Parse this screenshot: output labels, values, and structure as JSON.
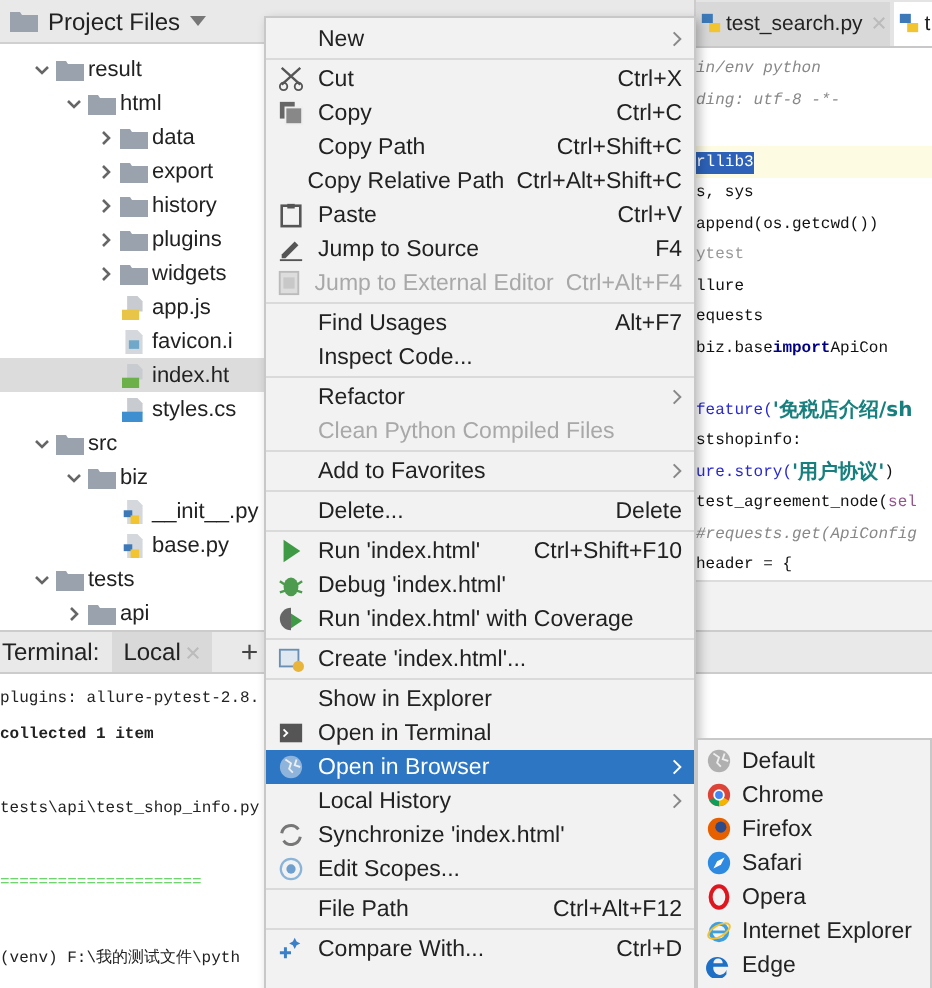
{
  "project": {
    "title": "Project Files",
    "tree": [
      {
        "label": "result",
        "kind": "folder",
        "expanded": true,
        "selected": false,
        "children": [
          {
            "label": "html",
            "kind": "folder",
            "expanded": true,
            "selected": false,
            "children": [
              {
                "label": "data",
                "kind": "folder",
                "expanded": false,
                "selected": false
              },
              {
                "label": "export",
                "kind": "folder",
                "expanded": false,
                "selected": false
              },
              {
                "label": "history",
                "kind": "folder",
                "expanded": false,
                "selected": false
              },
              {
                "label": "plugins",
                "kind": "folder",
                "expanded": false,
                "selected": false
              },
              {
                "label": "widgets",
                "kind": "folder",
                "expanded": false,
                "selected": false
              },
              {
                "label": "app.js",
                "kind": "js",
                "selected": false
              },
              {
                "label": "favicon.i",
                "kind": "image",
                "selected": false
              },
              {
                "label": "index.ht",
                "kind": "html",
                "selected": true
              },
              {
                "label": "styles.cs",
                "kind": "css",
                "selected": false
              }
            ]
          }
        ]
      },
      {
        "label": "src",
        "kind": "folder",
        "expanded": true,
        "selected": false,
        "children": [
          {
            "label": "biz",
            "kind": "folder",
            "expanded": true,
            "selected": false,
            "children": [
              {
                "label": "__init__.py",
                "kind": "python",
                "selected": false
              },
              {
                "label": "base.py",
                "kind": "python",
                "selected": false
              }
            ]
          }
        ]
      },
      {
        "label": "tests",
        "kind": "folder",
        "expanded": true,
        "selected": false,
        "children": [
          {
            "label": "api",
            "kind": "folder",
            "expanded": false,
            "selected": false
          }
        ]
      }
    ]
  },
  "editor": {
    "tabs": [
      {
        "label": "test_search.py",
        "selected": false,
        "closable": true
      },
      {
        "label": "t",
        "selected": true,
        "closable": false
      }
    ],
    "lines": [
      {
        "current": false,
        "segments": [
          {
            "text": "in/env python",
            "kind": "comment"
          }
        ]
      },
      {
        "current": false,
        "segments": [
          {
            "text": "ding: utf-8 -*-",
            "kind": "comment"
          }
        ]
      },
      {
        "current": false
      },
      {
        "current": true,
        "segments": [
          {
            "text": "rllib3",
            "kind": "selection"
          }
        ]
      },
      {
        "current": false,
        "segments": [
          {
            "text": "s, sys",
            "kind": "plain"
          }
        ]
      },
      {
        "current": false,
        "segments": [
          {
            "text": " append(os.getcwd())",
            "kind": "plain"
          }
        ]
      },
      {
        "current": false,
        "segments": [
          {
            "text": "ytest",
            "kind": "dim"
          }
        ]
      },
      {
        "current": false,
        "segments": [
          {
            "text": "llure",
            "kind": "plain"
          }
        ]
      },
      {
        "current": false,
        "segments": [
          {
            "text": "equests",
            "kind": "plain"
          }
        ]
      },
      {
        "current": false,
        "segments": [
          {
            "text": "biz.base ",
            "kind": "plain"
          },
          {
            "text": "import",
            "kind": "keyword"
          },
          {
            "text": " ApiCon",
            "kind": "plain"
          }
        ]
      },
      {
        "current": false
      },
      {
        "current": false,
        "segments": [
          {
            "text": "feature(",
            "kind": "decorator"
          },
          {
            "text": "'免税店介绍/sh",
            "kind": "string"
          }
        ]
      },
      {
        "current": false,
        "segments": [
          {
            "text": "stshopinfo:",
            "kind": "plain"
          }
        ]
      },
      {
        "current": false,
        "segments": [
          {
            "text": "ure.story(",
            "kind": "decorator"
          },
          {
            "text": "'用户协议'",
            "kind": "string"
          },
          {
            "text": ")",
            "kind": "plain"
          }
        ]
      },
      {
        "current": false,
        "segments": [
          {
            "text": "test_agreement_node(",
            "kind": "plain"
          },
          {
            "text": "sel",
            "kind": "self"
          }
        ]
      },
      {
        "current": false,
        "segments": [
          {
            "text": "#requests.get(ApiConfig",
            "kind": "comment"
          }
        ]
      },
      {
        "current": false,
        "segments": [
          {
            "text": "header = {",
            "kind": "plain"
          }
        ]
      }
    ]
  },
  "terminal": {
    "label": "Terminal:",
    "tabs": [
      {
        "label": "Local",
        "selected": true
      }
    ],
    "add": "+",
    "lines": [
      {
        "kind": "plain",
        "text": "plugins: allure-pytest-2.8."
      },
      {
        "kind": "bold",
        "text": "collected 1 item"
      },
      {
        "kind": "blank"
      },
      {
        "kind": "plain",
        "text": "tests\\api\\test_shop_info.py"
      },
      {
        "kind": "blank"
      },
      {
        "kind": "rule",
        "text": "====================="
      },
      {
        "kind": "blank"
      },
      {
        "kind": "plain",
        "text": "(venv) F:\\我的测试文件\\pyth"
      }
    ]
  },
  "menu": {
    "items": [
      {
        "kind": "item",
        "label": "New",
        "has_submenu": true,
        "disabled": false,
        "selected": false
      },
      {
        "kind": "separator"
      },
      {
        "kind": "item",
        "label": "Cut",
        "shortcut": "Ctrl+X",
        "has_submenu": false,
        "disabled": false,
        "selected": false
      },
      {
        "kind": "item",
        "label": "Copy",
        "shortcut": "Ctrl+C",
        "has_submenu": false,
        "disabled": false,
        "selected": false
      },
      {
        "kind": "item",
        "label": "Copy Path",
        "shortcut": "Ctrl+Shift+C",
        "has_submenu": false,
        "disabled": false,
        "selected": false
      },
      {
        "kind": "item",
        "label": "Copy Relative Path",
        "shortcut": "Ctrl+Alt+Shift+C",
        "has_submenu": false,
        "disabled": false,
        "selected": false
      },
      {
        "kind": "item",
        "label": "Paste",
        "shortcut": "Ctrl+V",
        "has_submenu": false,
        "disabled": false,
        "selected": false
      },
      {
        "kind": "item",
        "label": "Jump to Source",
        "shortcut": "F4",
        "has_submenu": false,
        "disabled": false,
        "selected": false
      },
      {
        "kind": "item",
        "label": "Jump to External Editor",
        "shortcut": "Ctrl+Alt+F4",
        "has_submenu": false,
        "disabled": true,
        "selected": false
      },
      {
        "kind": "separator"
      },
      {
        "kind": "item",
        "label": "Find Usages",
        "shortcut": "Alt+F7",
        "has_submenu": false,
        "disabled": false,
        "selected": false
      },
      {
        "kind": "item",
        "label": "Inspect Code...",
        "has_submenu": false,
        "disabled": false,
        "selected": false
      },
      {
        "kind": "separator"
      },
      {
        "kind": "item",
        "label": "Refactor",
        "has_submenu": true,
        "disabled": false,
        "selected": false
      },
      {
        "kind": "item",
        "label": "Clean Python Compiled Files",
        "has_submenu": false,
        "disabled": true,
        "selected": false
      },
      {
        "kind": "separator"
      },
      {
        "kind": "item",
        "label": "Add to Favorites",
        "has_submenu": true,
        "disabled": false,
        "selected": false
      },
      {
        "kind": "separator"
      },
      {
        "kind": "item",
        "label": "Delete...",
        "shortcut": "Delete",
        "has_submenu": false,
        "disabled": false,
        "selected": false
      },
      {
        "kind": "separator"
      },
      {
        "kind": "item",
        "label": "Run 'index.html'",
        "shortcut": "Ctrl+Shift+F10",
        "has_submenu": false,
        "disabled": false,
        "selected": false
      },
      {
        "kind": "item",
        "label": "Debug 'index.html'",
        "has_submenu": false,
        "disabled": false,
        "selected": false
      },
      {
        "kind": "item",
        "label": "Run 'index.html' with Coverage",
        "has_submenu": false,
        "disabled": false,
        "selected": false
      },
      {
        "kind": "separator"
      },
      {
        "kind": "item",
        "label": "Create 'index.html'...",
        "has_submenu": false,
        "disabled": false,
        "selected": false
      },
      {
        "kind": "separator"
      },
      {
        "kind": "item",
        "label": "Show in Explorer",
        "has_submenu": false,
        "disabled": false,
        "selected": false
      },
      {
        "kind": "item",
        "label": "Open in Terminal",
        "has_submenu": false,
        "disabled": false,
        "selected": false
      },
      {
        "kind": "item",
        "label": "Open in Browser",
        "has_submenu": true,
        "disabled": false,
        "selected": true
      },
      {
        "kind": "item",
        "label": "Local History",
        "has_submenu": true,
        "disabled": false,
        "selected": false
      },
      {
        "kind": "item",
        "label": "Synchronize 'index.html'",
        "has_submenu": false,
        "disabled": false,
        "selected": false
      },
      {
        "kind": "item",
        "label": "Edit Scopes...",
        "has_submenu": false,
        "disabled": false,
        "selected": false
      },
      {
        "kind": "separator"
      },
      {
        "kind": "item",
        "label": "File Path",
        "shortcut": "Ctrl+Alt+F12",
        "has_submenu": false,
        "disabled": false,
        "selected": false
      },
      {
        "kind": "separator"
      },
      {
        "kind": "item",
        "label": "Compare With...",
        "shortcut": "Ctrl+D",
        "has_submenu": false,
        "disabled": false,
        "selected": false
      }
    ]
  },
  "browser_menu": {
    "items": [
      {
        "label": "Default",
        "selected": false
      },
      {
        "label": "Chrome",
        "selected": false
      },
      {
        "label": "Firefox",
        "selected": false
      },
      {
        "label": "Safari",
        "selected": false
      },
      {
        "label": "Opera",
        "selected": false
      },
      {
        "label": "Internet Explorer",
        "selected": false
      },
      {
        "label": "Edge",
        "selected": false
      }
    ]
  }
}
